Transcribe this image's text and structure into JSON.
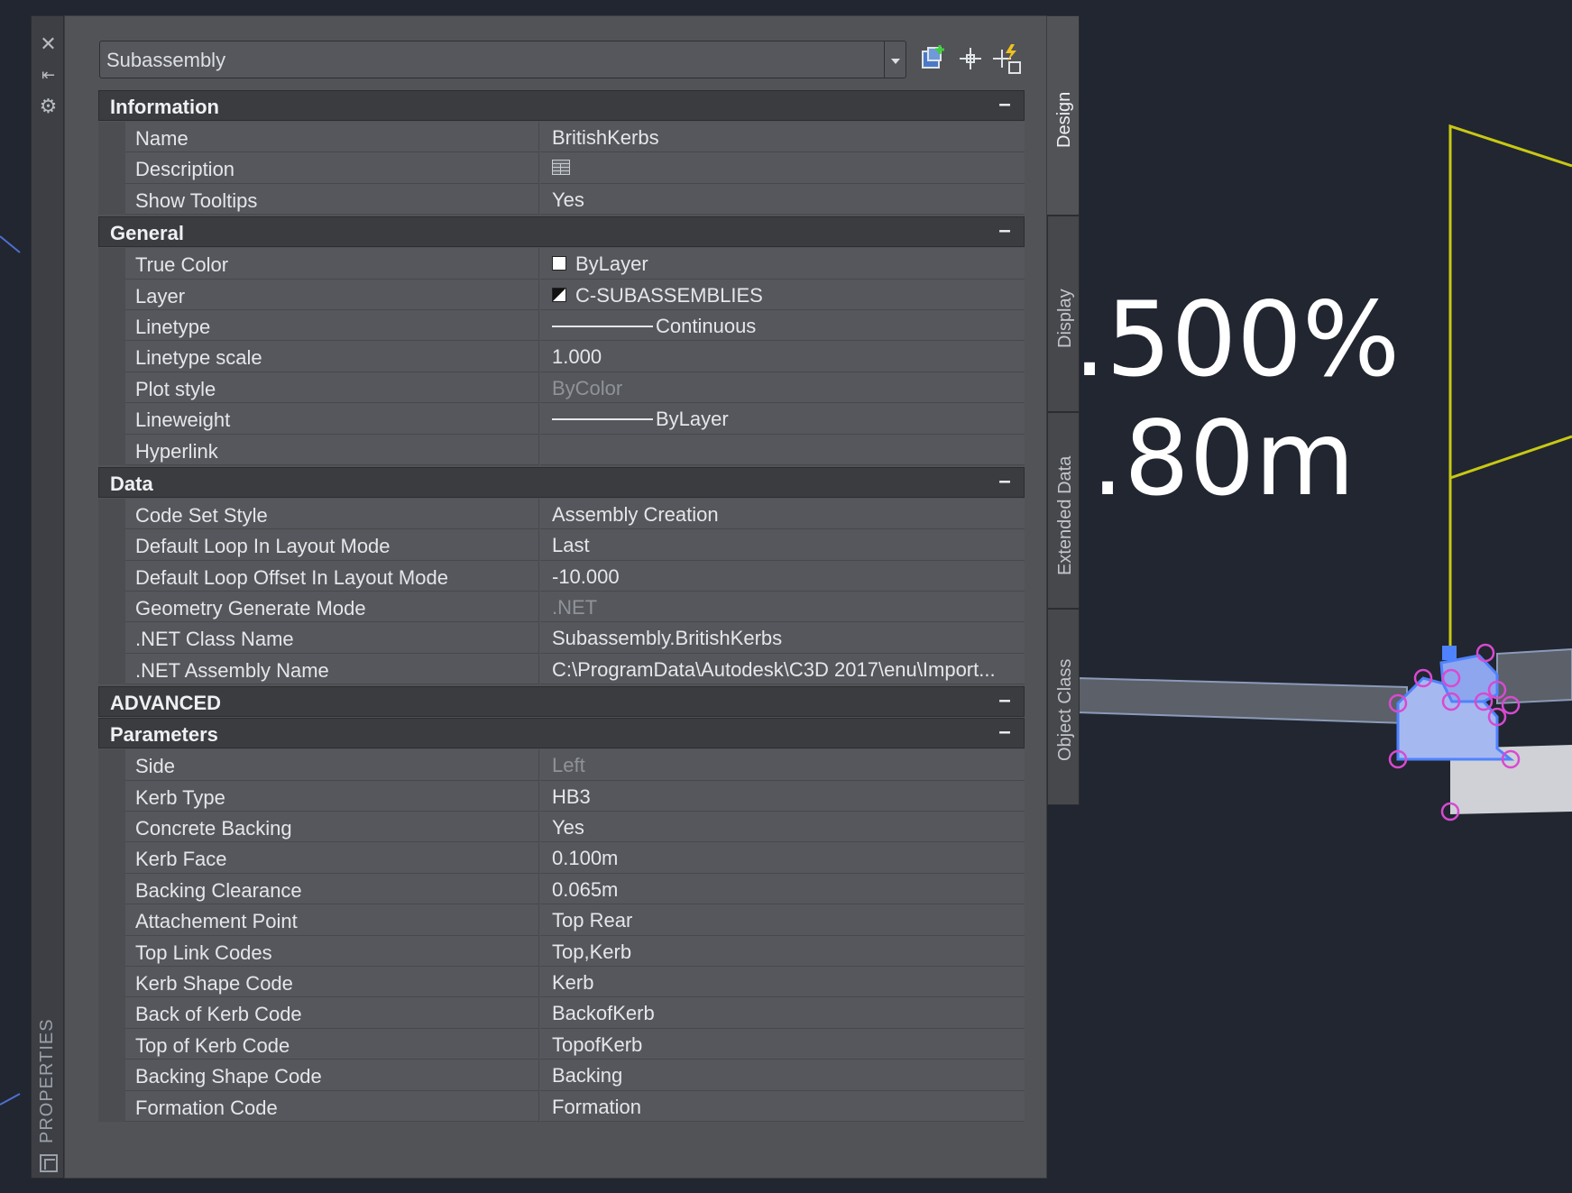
{
  "canvas": {
    "text_line_1": ".500%",
    "text_line_2": ".80m"
  },
  "palette": {
    "title": "PROPERTIES"
  },
  "selector": {
    "value": "Subassembly"
  },
  "tabs": [
    {
      "label": "Design"
    },
    {
      "label": "Display"
    },
    {
      "label": "Extended Data"
    },
    {
      "label": "Object Class"
    }
  ],
  "sections": {
    "information": {
      "title": "Information",
      "rows": [
        {
          "label": "Name",
          "value": "BritishKerbs"
        },
        {
          "label": "Description",
          "value": ""
        },
        {
          "label": "Show Tooltips",
          "value": "Yes"
        }
      ]
    },
    "general": {
      "title": "General",
      "rows": [
        {
          "label": "True Color",
          "value": "ByLayer"
        },
        {
          "label": "Layer",
          "value": "C-SUBASSEMBLIES"
        },
        {
          "label": "Linetype",
          "value": "Continuous"
        },
        {
          "label": "Linetype scale",
          "value": "1.000"
        },
        {
          "label": "Plot style",
          "value": "ByColor"
        },
        {
          "label": "Lineweight",
          "value": "ByLayer"
        },
        {
          "label": "Hyperlink",
          "value": ""
        }
      ]
    },
    "data": {
      "title": "Data",
      "rows": [
        {
          "label": "Code Set Style",
          "value": "Assembly Creation"
        },
        {
          "label": "Default Loop In Layout Mode",
          "value": "Last"
        },
        {
          "label": "Default Loop Offset In Layout Mode",
          "value": "-10.000"
        },
        {
          "label": "Geometry Generate Mode",
          "value": ".NET"
        },
        {
          "label": ".NET Class Name",
          "value": "Subassembly.BritishKerbs"
        },
        {
          "label": ".NET Assembly Name",
          "value": "C:\\ProgramData\\Autodesk\\C3D  2017\\enu\\Import..."
        }
      ]
    },
    "advanced": {
      "title": "ADVANCED"
    },
    "parameters": {
      "title": "Parameters",
      "rows": [
        {
          "label": "Side",
          "value": "Left"
        },
        {
          "label": "Kerb Type",
          "value": "HB3"
        },
        {
          "label": "Concrete Backing",
          "value": "Yes"
        },
        {
          "label": "Kerb Face",
          "value": "0.100m"
        },
        {
          "label": "Backing Clearance",
          "value": "0.065m"
        },
        {
          "label": "Attachement Point",
          "value": "Top Rear"
        },
        {
          "label": "Top Link Codes",
          "value": "Top,Kerb"
        },
        {
          "label": "Kerb Shape Code",
          "value": "Kerb"
        },
        {
          "label": "Back of Kerb Code",
          "value": "BackofKerb"
        },
        {
          "label": "Top of Kerb Code",
          "value": "TopofKerb"
        },
        {
          "label": "Backing Shape Code",
          "value": "Backing"
        },
        {
          "label": "Formation Code",
          "value": "Formation"
        }
      ]
    }
  },
  "colors": {
    "canvas_bg": "#212630",
    "panel_bg": "#515357",
    "header_bg": "#3a3c40",
    "row_bg": "#55575c",
    "yellow_line": "#c8c814",
    "grip_blue": "#4f82ff",
    "grip_magenta": "#d84ad0"
  }
}
